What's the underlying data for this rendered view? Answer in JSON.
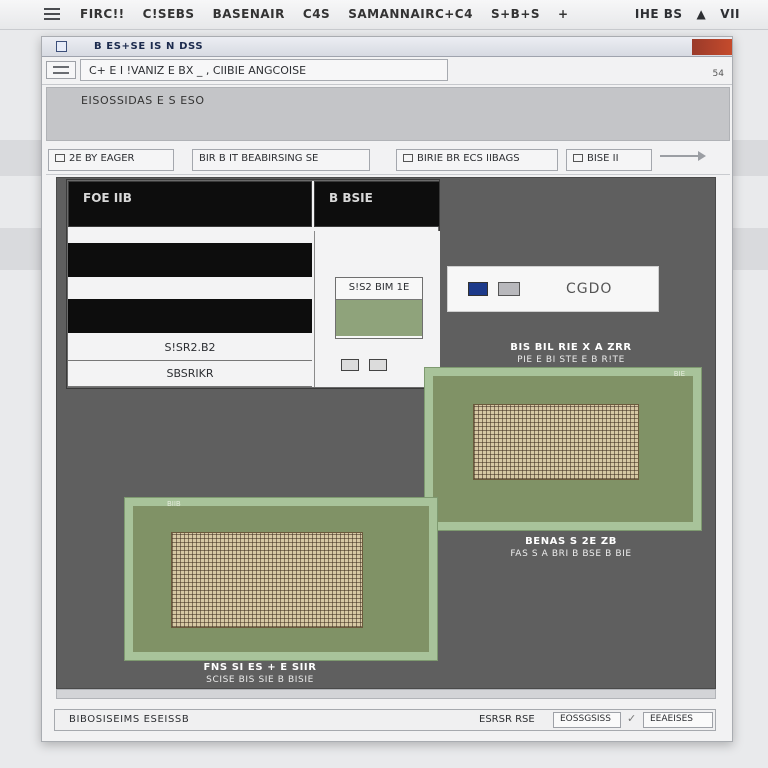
{
  "system_bar": {
    "items": [
      "FIRC!!",
      "C!SEBS",
      "BASENAIR",
      "C4S",
      "SAMANNAIRC+C4",
      "S+B+S",
      "+"
    ],
    "right": [
      "IHE BS",
      "▲",
      "VII"
    ]
  },
  "window": {
    "title": "B ES+SE IS N DSS",
    "menubar": {
      "field": "C+ E I  !VANIZ E BX _ ,  CIIBIE  ANGCOISE",
      "page_counter": "54"
    },
    "header_title": "EISOSSIDAS E S ESO",
    "toolbar": {
      "group1": "2E BY EAGER",
      "group2": "BIR B IT BEABIRSING SE",
      "group3": "BIRIE BR ECS IIBAGS",
      "group4": "BISE II"
    }
  },
  "canvas": {
    "table": {
      "header_left": "FOE IIB",
      "header_right": "B BSIE",
      "row_label_1": "S!SR2.B2",
      "row_label_2": "SBSRIKR",
      "mini_card_label": "S!S2 BIM 1E"
    },
    "code_box": {
      "text": "CGDO"
    },
    "caption_top": {
      "line1": "BIS BIL RIE X A ZRR",
      "line2": "PIE E BI STE E B R!TE"
    },
    "caption_right": {
      "line1": "BENAS S 2E ZB",
      "line2": "FAS S A BRI B BSE B BIE"
    },
    "caption_bottom": {
      "line1": "FNS SI ES + E SIIR",
      "line2": "SCISE BIS SIE B BISIE"
    },
    "card_top_label": "BIE",
    "card_bottom_label": "BIIB"
  },
  "statusbar": {
    "left": "BIBOSISEIMS ESEISSB",
    "mid": "ESRSR RSE",
    "button1": "EOSSGSISS",
    "button2": "EEAEISES"
  }
}
